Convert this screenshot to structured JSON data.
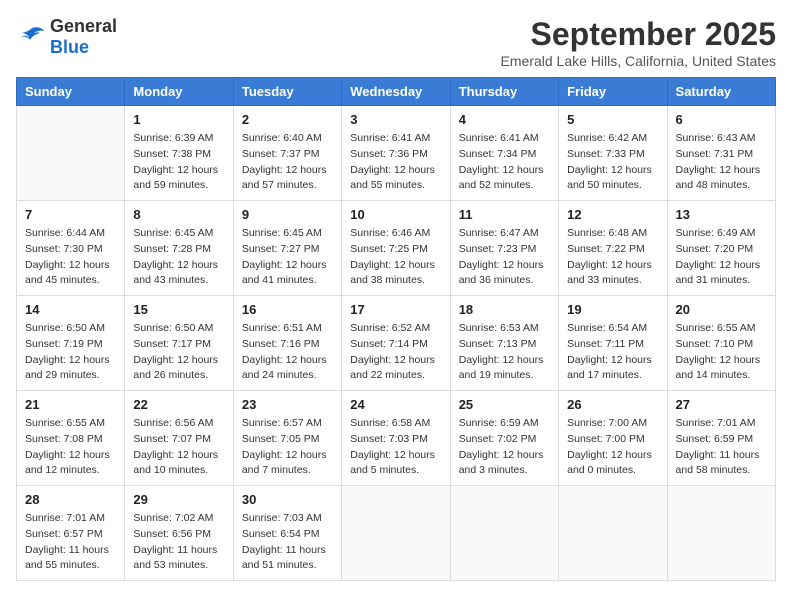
{
  "header": {
    "logo": {
      "general": "General",
      "blue": "Blue"
    },
    "title": "September 2025",
    "location": "Emerald Lake Hills, California, United States"
  },
  "weekdays": [
    "Sunday",
    "Monday",
    "Tuesday",
    "Wednesday",
    "Thursday",
    "Friday",
    "Saturday"
  ],
  "weeks": [
    [
      {
        "day": "",
        "empty": true
      },
      {
        "day": "1",
        "sunrise": "Sunrise: 6:39 AM",
        "sunset": "Sunset: 7:38 PM",
        "daylight": "Daylight: 12 hours and 59 minutes."
      },
      {
        "day": "2",
        "sunrise": "Sunrise: 6:40 AM",
        "sunset": "Sunset: 7:37 PM",
        "daylight": "Daylight: 12 hours and 57 minutes."
      },
      {
        "day": "3",
        "sunrise": "Sunrise: 6:41 AM",
        "sunset": "Sunset: 7:36 PM",
        "daylight": "Daylight: 12 hours and 55 minutes."
      },
      {
        "day": "4",
        "sunrise": "Sunrise: 6:41 AM",
        "sunset": "Sunset: 7:34 PM",
        "daylight": "Daylight: 12 hours and 52 minutes."
      },
      {
        "day": "5",
        "sunrise": "Sunrise: 6:42 AM",
        "sunset": "Sunset: 7:33 PM",
        "daylight": "Daylight: 12 hours and 50 minutes."
      },
      {
        "day": "6",
        "sunrise": "Sunrise: 6:43 AM",
        "sunset": "Sunset: 7:31 PM",
        "daylight": "Daylight: 12 hours and 48 minutes."
      }
    ],
    [
      {
        "day": "7",
        "sunrise": "Sunrise: 6:44 AM",
        "sunset": "Sunset: 7:30 PM",
        "daylight": "Daylight: 12 hours and 45 minutes."
      },
      {
        "day": "8",
        "sunrise": "Sunrise: 6:45 AM",
        "sunset": "Sunset: 7:28 PM",
        "daylight": "Daylight: 12 hours and 43 minutes."
      },
      {
        "day": "9",
        "sunrise": "Sunrise: 6:45 AM",
        "sunset": "Sunset: 7:27 PM",
        "daylight": "Daylight: 12 hours and 41 minutes."
      },
      {
        "day": "10",
        "sunrise": "Sunrise: 6:46 AM",
        "sunset": "Sunset: 7:25 PM",
        "daylight": "Daylight: 12 hours and 38 minutes."
      },
      {
        "day": "11",
        "sunrise": "Sunrise: 6:47 AM",
        "sunset": "Sunset: 7:23 PM",
        "daylight": "Daylight: 12 hours and 36 minutes."
      },
      {
        "day": "12",
        "sunrise": "Sunrise: 6:48 AM",
        "sunset": "Sunset: 7:22 PM",
        "daylight": "Daylight: 12 hours and 33 minutes."
      },
      {
        "day": "13",
        "sunrise": "Sunrise: 6:49 AM",
        "sunset": "Sunset: 7:20 PM",
        "daylight": "Daylight: 12 hours and 31 minutes."
      }
    ],
    [
      {
        "day": "14",
        "sunrise": "Sunrise: 6:50 AM",
        "sunset": "Sunset: 7:19 PM",
        "daylight": "Daylight: 12 hours and 29 minutes."
      },
      {
        "day": "15",
        "sunrise": "Sunrise: 6:50 AM",
        "sunset": "Sunset: 7:17 PM",
        "daylight": "Daylight: 12 hours and 26 minutes."
      },
      {
        "day": "16",
        "sunrise": "Sunrise: 6:51 AM",
        "sunset": "Sunset: 7:16 PM",
        "daylight": "Daylight: 12 hours and 24 minutes."
      },
      {
        "day": "17",
        "sunrise": "Sunrise: 6:52 AM",
        "sunset": "Sunset: 7:14 PM",
        "daylight": "Daylight: 12 hours and 22 minutes."
      },
      {
        "day": "18",
        "sunrise": "Sunrise: 6:53 AM",
        "sunset": "Sunset: 7:13 PM",
        "daylight": "Daylight: 12 hours and 19 minutes."
      },
      {
        "day": "19",
        "sunrise": "Sunrise: 6:54 AM",
        "sunset": "Sunset: 7:11 PM",
        "daylight": "Daylight: 12 hours and 17 minutes."
      },
      {
        "day": "20",
        "sunrise": "Sunrise: 6:55 AM",
        "sunset": "Sunset: 7:10 PM",
        "daylight": "Daylight: 12 hours and 14 minutes."
      }
    ],
    [
      {
        "day": "21",
        "sunrise": "Sunrise: 6:55 AM",
        "sunset": "Sunset: 7:08 PM",
        "daylight": "Daylight: 12 hours and 12 minutes."
      },
      {
        "day": "22",
        "sunrise": "Sunrise: 6:56 AM",
        "sunset": "Sunset: 7:07 PM",
        "daylight": "Daylight: 12 hours and 10 minutes."
      },
      {
        "day": "23",
        "sunrise": "Sunrise: 6:57 AM",
        "sunset": "Sunset: 7:05 PM",
        "daylight": "Daylight: 12 hours and 7 minutes."
      },
      {
        "day": "24",
        "sunrise": "Sunrise: 6:58 AM",
        "sunset": "Sunset: 7:03 PM",
        "daylight": "Daylight: 12 hours and 5 minutes."
      },
      {
        "day": "25",
        "sunrise": "Sunrise: 6:59 AM",
        "sunset": "Sunset: 7:02 PM",
        "daylight": "Daylight: 12 hours and 3 minutes."
      },
      {
        "day": "26",
        "sunrise": "Sunrise: 7:00 AM",
        "sunset": "Sunset: 7:00 PM",
        "daylight": "Daylight: 12 hours and 0 minutes."
      },
      {
        "day": "27",
        "sunrise": "Sunrise: 7:01 AM",
        "sunset": "Sunset: 6:59 PM",
        "daylight": "Daylight: 11 hours and 58 minutes."
      }
    ],
    [
      {
        "day": "28",
        "sunrise": "Sunrise: 7:01 AM",
        "sunset": "Sunset: 6:57 PM",
        "daylight": "Daylight: 11 hours and 55 minutes."
      },
      {
        "day": "29",
        "sunrise": "Sunrise: 7:02 AM",
        "sunset": "Sunset: 6:56 PM",
        "daylight": "Daylight: 11 hours and 53 minutes."
      },
      {
        "day": "30",
        "sunrise": "Sunrise: 7:03 AM",
        "sunset": "Sunset: 6:54 PM",
        "daylight": "Daylight: 11 hours and 51 minutes."
      },
      {
        "day": "",
        "empty": true
      },
      {
        "day": "",
        "empty": true
      },
      {
        "day": "",
        "empty": true
      },
      {
        "day": "",
        "empty": true
      }
    ]
  ]
}
